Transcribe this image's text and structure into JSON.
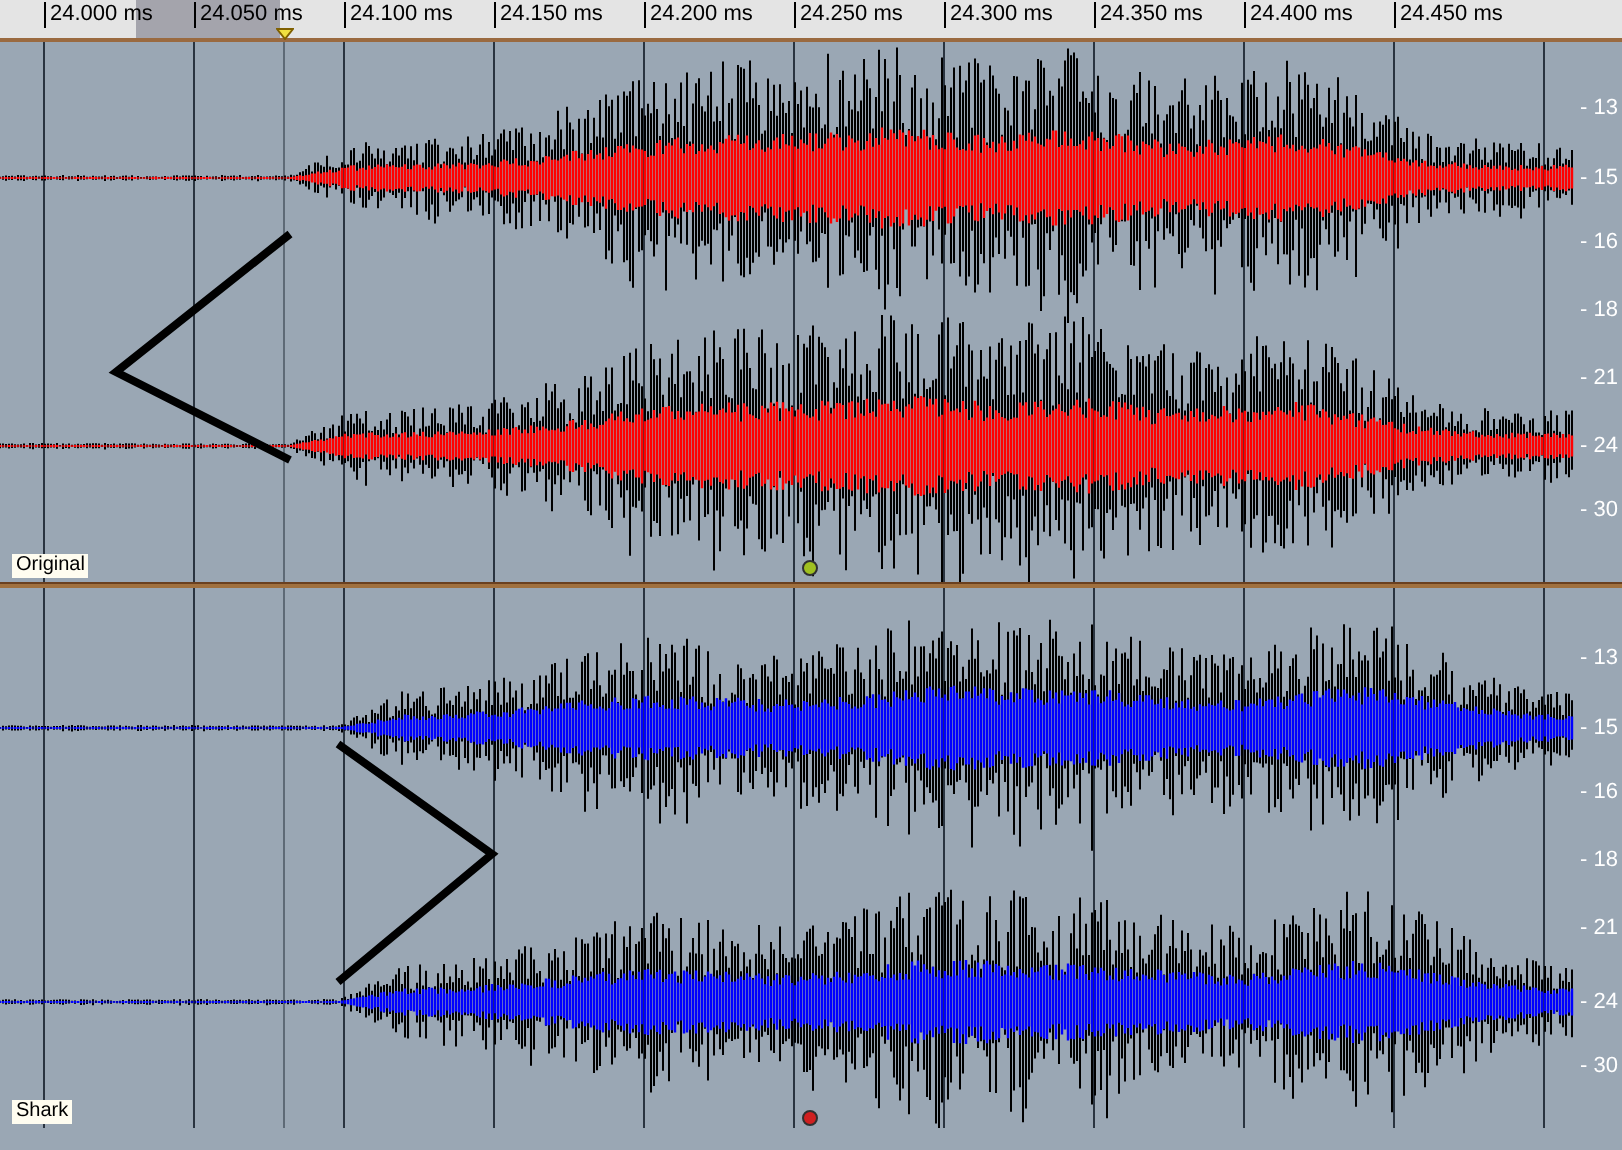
{
  "ruler": {
    "ticks": [
      "24.000 ms",
      "24.050 ms",
      "24.100 ms",
      "24.150 ms",
      "24.200 ms",
      "24.250 ms",
      "24.300 ms",
      "24.350 ms",
      "24.400 ms",
      "24.450 ms"
    ]
  },
  "tracks": [
    {
      "name": "Original",
      "color": "#ff0000",
      "annotation": {
        "kind": "left-chevron"
      },
      "db_scale": [
        "- 13",
        "- 15",
        "- 16",
        "- 18",
        "- 21",
        "- 24",
        "- 30"
      ]
    },
    {
      "name": "Shark",
      "color": "#0000ff",
      "annotation": {
        "kind": "right-chevron"
      },
      "db_scale": [
        "- 13",
        "- 15",
        "- 16",
        "- 18",
        "- 21",
        "- 24",
        "- 30"
      ]
    }
  ]
}
